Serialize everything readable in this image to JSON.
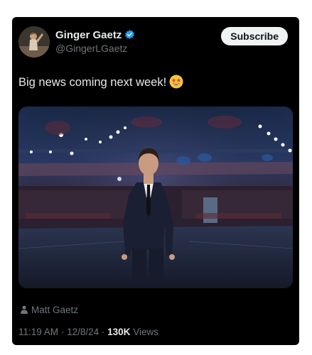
{
  "post": {
    "author_name": "Ginger Gaetz",
    "author_handle": "@GingerLGaetz",
    "subscribe_label": "Subscribe",
    "text": "Big news coming next week!",
    "emoji": "star-struck-emoji",
    "media_credit": "Matt Gaetz",
    "time": "11:19 AM",
    "date": "12/8/24",
    "separator": "·",
    "views_count": "130K",
    "views_label": "Views"
  },
  "colors": {
    "card_bg": "#000000",
    "text_primary": "#e7e9ea",
    "text_secondary": "#71767b",
    "verified_badge": "#1d9bf0",
    "subscribe_bg": "#eff3f4"
  },
  "icons": [
    "verified-badge-icon",
    "person-icon"
  ]
}
